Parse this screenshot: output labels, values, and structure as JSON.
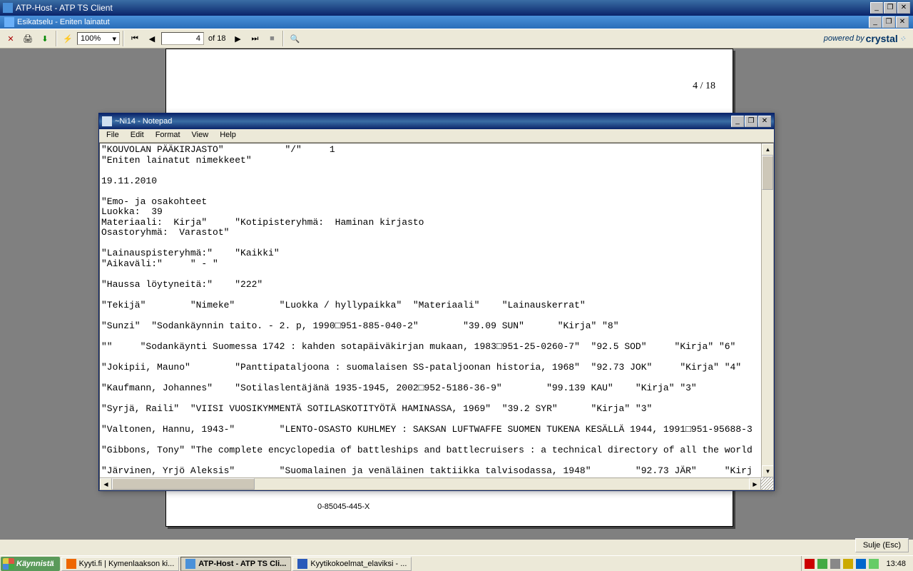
{
  "main_window": {
    "title": "ATP-Host - ATP TS Client"
  },
  "subwindow": {
    "title": "Esikatselu - Eniten lainatut"
  },
  "toolbar": {
    "zoom": "100%",
    "page_current": "4",
    "page_of": "of 18"
  },
  "crystal": {
    "small": "powered by",
    "big": "crystal"
  },
  "page_counter": "4 / 18",
  "page_footer_line2": "0-85045-445-X",
  "notepad": {
    "title": "~Ni14 - Notepad",
    "menu": {
      "file": "File",
      "edit": "Edit",
      "format": "Format",
      "view": "View",
      "help": "Help"
    },
    "content": "\"KOUVOLAN PÄÄKIRJASTO\"           \"/\"     1\n\"Eniten lainatut nimekkeet\"\n\n19.11.2010\n\n\"Emo- ja osakohteet\nLuokka:  39\nMateriaali:  Kirja\"     \"Kotipisteryhmä:  Haminan kirjasto\nOsastoryhmä:  Varastot\"\n\n\"Lainauspisteryhmä:\"    \"Kaikki\"\n\"Aikaväli:\"     \" - \"\n\n\"Haussa löytyneitä:\"    \"222\"\n\n\"Tekijä\"        \"Nimeke\"        \"Luokka / hyllypaikka\"  \"Materiaali\"    \"Lainauskerrat\"\n\n\"Sunzi\"  \"Sodankäynnin taito. - 2. p, 1990□951-885-040-2\"        \"39.09 SUN\"      \"Kirja\" \"8\"\n\n\"\"     \"Sodankäynti Suomessa 1742 : kahden sotapäiväkirjan mukaan, 1983□951-25-0260-7\"  \"92.5 SOD\"     \"Kirja\" \"6\"\n\n\"Jokipii, Mauno\"        \"Panttipataljoona : suomalaisen SS-pataljoonan historia, 1968\"  \"92.73 JOK\"     \"Kirja\" \"4\"\n\n\"Kaufmann, Johannes\"    \"Sotilaslentäjänä 1935-1945, 2002□952-5186-36-9\"        \"99.139 KAU\"    \"Kirja\" \"3\"\n\n\"Syrjä, Raili\"  \"VIISI VUOSIKYMMENTÄ SOTILASKOTITYÖTÄ HAMINASSA, 1969\"  \"39.2 SYR\"      \"Kirja\" \"3\"\n\n\"Valtonen, Hannu, 1943-\"        \"LENTO-OSASTO KUHLMEY : SAKSAN LUFTWAFFE SUOMEN TUKENA KESÄLLÄ 1944, 1991□951-95688-3\n\n\"Gibbons, Tony\" \"The complete encyclopedia of battleships and battlecruisers : a technical directory of all the world\n\n\"Järvinen, Yrjö Aleksis\"        \"Suomalainen ja venäläinen taktiikka talvisodassa, 1948\"        \"92.73 JÄR\"     \"Kirj"
  },
  "footer_button": "Sulje (Esc)",
  "taskbar": {
    "start": "Käynnistä",
    "items": [
      "Kyyti.fi | Kymenlaakson ki...",
      "ATP-Host - ATP TS Cli...",
      "Kyytikokoelmat_elaviksi - ..."
    ],
    "clock": "13:48"
  }
}
